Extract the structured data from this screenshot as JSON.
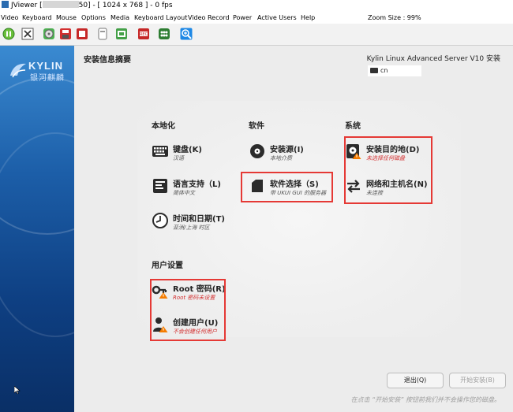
{
  "window": {
    "title_prefix": "JViewer [",
    "title_suffix": "50] - [ 1024 x 768 ] - 0 fps"
  },
  "menubar": {
    "items": [
      "Video",
      "Keyboard",
      "Mouse",
      "Options",
      "Media",
      "Keyboard Layout",
      "Video Record",
      "Power",
      "Active Users",
      "Help"
    ],
    "zoom_label": "Zoom Size : 99%"
  },
  "toolbar": {
    "buttons": [
      "pause-icon",
      "fullscreen-icon",
      "cd-icon",
      "floppy-icon",
      "stop-icon",
      "keyboard-lock-icon",
      "record-icon",
      "video-icon",
      "hard-drive-icon",
      "zoom-in-icon"
    ]
  },
  "sidebar": {
    "logo_text": "KYLIN",
    "logo_subtext": "银河麒麟"
  },
  "header": {
    "page_title": "安装信息摘要",
    "product_title": "Kylin Linux Advanced Server V10 安装",
    "language": "cn"
  },
  "sections": {
    "localization": "本地化",
    "software": "软件",
    "system": "系统",
    "user_settings": "用户设置"
  },
  "spokes": {
    "keyboard": {
      "title": "键盘(K)",
      "status": "汉语"
    },
    "language": {
      "title": "语言支持（L)",
      "status": "简体中文"
    },
    "time": {
      "title": "时间和日期(T)",
      "status": "亚洲/上海 时区"
    },
    "source": {
      "title": "安装源(I)",
      "status": "本地介质"
    },
    "software": {
      "title": "软件选择（S)",
      "status": "带 UKUI GUI 的服务器"
    },
    "destination": {
      "title": "安装目的地(D)",
      "status": "未选择任何磁盘"
    },
    "network": {
      "title": "网络和主机名(N)",
      "status": "未连接"
    },
    "root": {
      "title": "Root 密码(R)",
      "status": "Root 密码未设置"
    },
    "user": {
      "title": "创建用户(U)",
      "status": "不会创建任何用户"
    }
  },
  "footer": {
    "quit_label": "退出(Q)",
    "begin_label": "开始安装(B)",
    "note": "在点击 “开始安装” 按钮前我们并不会操作您的磁盘。"
  },
  "colors": {
    "highlight": "#e53935",
    "warning_text": "#d32f2f",
    "sidebar_blue": "#1c5ea8"
  }
}
